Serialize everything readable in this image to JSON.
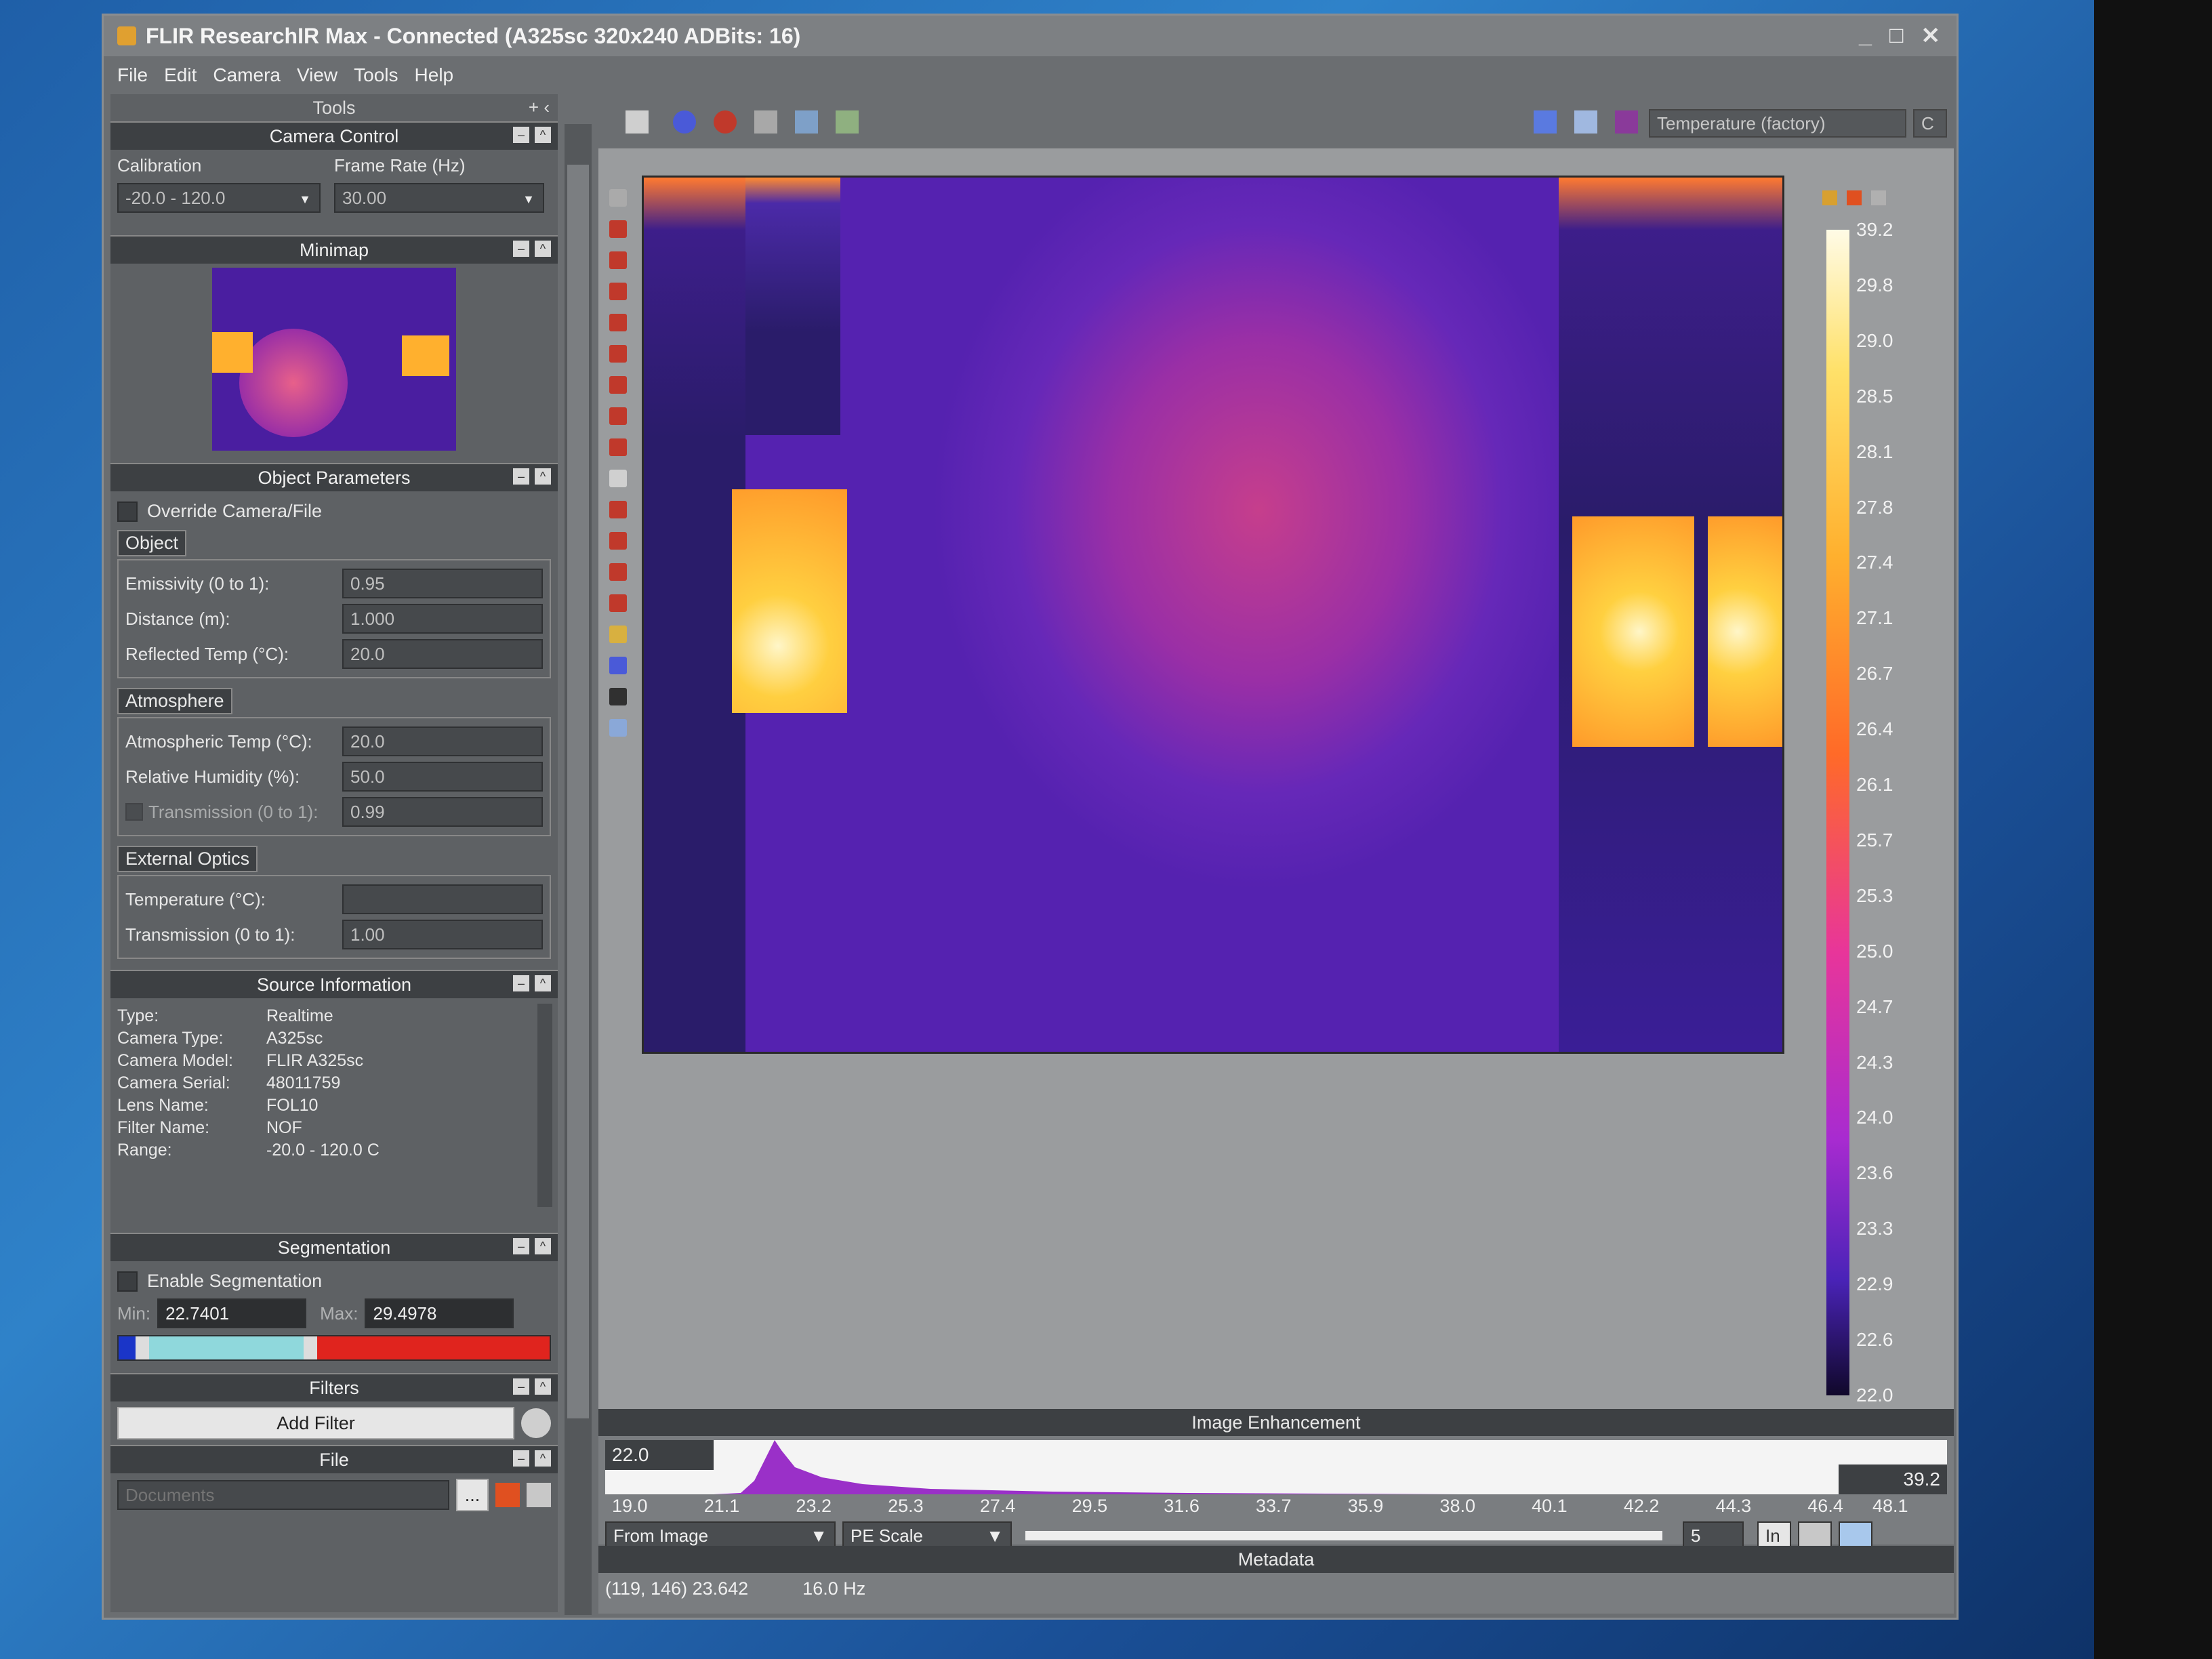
{
  "window": {
    "title": "FLIR ResearchIR Max - Connected (A325sc 320x240 ADBits: 16)",
    "controls": [
      "_",
      "□",
      "✕"
    ]
  },
  "menu": [
    "File",
    "Edit",
    "Camera",
    "View",
    "Tools",
    "Help"
  ],
  "tools_panel": {
    "title": "Tools",
    "camera_control": {
      "title": "Camera Control",
      "calibration_label": "Calibration",
      "calibration_value": "-20.0 - 120.0",
      "frame_rate_label": "Frame Rate (Hz)",
      "frame_rate_value": "30.00"
    },
    "minimap": {
      "title": "Minimap"
    },
    "object_parameters": {
      "title": "Object Parameters",
      "override_label": "Override Camera/File",
      "object_group": "Object",
      "emissivity_label": "Emissivity (0 to 1):",
      "emissivity_value": "0.95",
      "distance_label": "Distance (m):",
      "distance_value": "1.000",
      "reflected_label": "Reflected Temp (°C):",
      "reflected_value": "20.0",
      "atmosphere_group": "Atmosphere",
      "atm_temp_label": "Atmospheric Temp (°C):",
      "atm_temp_value": "20.0",
      "humidity_label": "Relative Humidity (%):",
      "humidity_value": "50.0",
      "transmission_label": "Transmission (0 to 1):",
      "transmission_value": "0.99",
      "ext_optics_group": "External Optics",
      "ext_temp_label": "Temperature (°C):",
      "ext_temp_value": "",
      "ext_trans_label": "Transmission (0 to 1):",
      "ext_trans_value": "1.00"
    },
    "source_information": {
      "title": "Source Information",
      "rows": [
        {
          "k": "Type:",
          "v": "Realtime"
        },
        {
          "k": "Camera Type:",
          "v": "A325sc"
        },
        {
          "k": "Camera Model:",
          "v": "FLIR A325sc"
        },
        {
          "k": "Camera Serial:",
          "v": "48011759"
        },
        {
          "k": "Lens Name:",
          "v": "FOL10"
        },
        {
          "k": "Filter Name:",
          "v": "NOF"
        },
        {
          "k": "Range:",
          "v": "-20.0 - 120.0 C"
        }
      ]
    },
    "segmentation": {
      "title": "Segmentation",
      "enable_label": "Enable Segmentation",
      "min_label": "Min:",
      "min_value": "22.7401",
      "max_label": "Max:",
      "max_value": "29.4978"
    },
    "filters": {
      "title": "Filters",
      "add_label": "Add Filter"
    },
    "file": {
      "title": "File",
      "path_placeholder": "Documents",
      "browse_label": "..."
    }
  },
  "viewer": {
    "mode_value": "Temperature (factory)",
    "unit_value": "C",
    "colorbar_labels": [
      "39.2",
      "29.8",
      "29.0",
      "28.5",
      "28.1",
      "27.8",
      "27.4",
      "27.1",
      "26.7",
      "26.4",
      "26.1",
      "25.7",
      "25.3",
      "25.0",
      "24.7",
      "24.3",
      "24.0",
      "23.6",
      "23.3",
      "22.9",
      "22.6",
      "22.0"
    ]
  },
  "enhancement": {
    "title": "Image Enhancement",
    "min_value": "22.0",
    "max_value": "39.2",
    "ticks": [
      "19.0",
      "21.1",
      "23.2",
      "25.3",
      "27.4",
      "29.5",
      "31.6",
      "33.7",
      "35.9",
      "38.0",
      "40.1",
      "42.2",
      "44.3",
      "46.4",
      "48.1"
    ],
    "source_value": "From Image",
    "scale_value": "PE Scale",
    "step_value": "5",
    "in_label": "In"
  },
  "metadata": {
    "title": "Metadata",
    "coords_value": "(119, 146) 23.642",
    "rate_value": "16.0 Hz"
  },
  "colors": {
    "accent_hot": "#ffb02e",
    "accent_mid": "#e8359a",
    "accent_cold": "#4a23b8"
  }
}
